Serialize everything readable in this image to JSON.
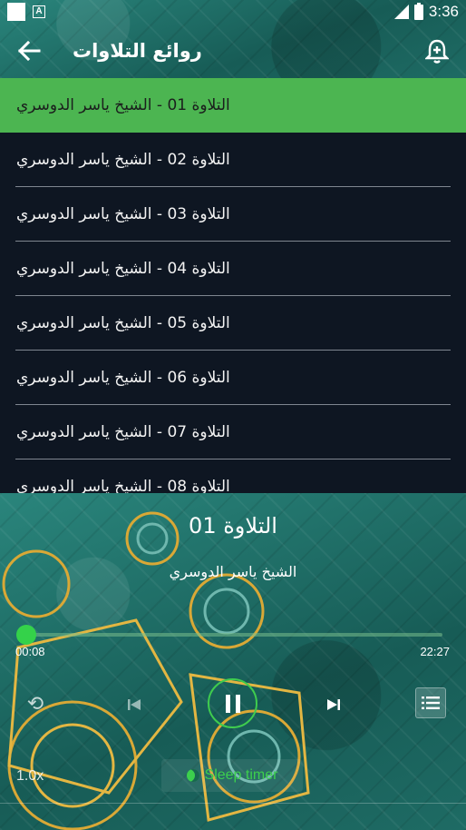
{
  "status_bar": {
    "time": "3:36",
    "icons": [
      "square-notification-icon",
      "a-notification-icon",
      "signal-icon",
      "battery-charging-icon"
    ]
  },
  "toolbar": {
    "title": "روائع التلاوات",
    "back_icon": "arrow-back-icon",
    "alarm_icon": "alarm-add-icon"
  },
  "colors": {
    "active_item": "#4cb551",
    "list_bg": "#0e1622",
    "accent_green": "#3fcc4e",
    "teal": "#1f6f68"
  },
  "tracks": [
    {
      "label": "التلاوة 01 - الشيخ ياسر الدوسري",
      "active": true
    },
    {
      "label": "التلاوة 02 - الشيخ ياسر الدوسري",
      "active": false
    },
    {
      "label": "التلاوة 03 - الشيخ ياسر الدوسري",
      "active": false
    },
    {
      "label": "التلاوة 04 - الشيخ ياسر الدوسري",
      "active": false
    },
    {
      "label": "التلاوة 05 - الشيخ ياسر الدوسري",
      "active": false
    },
    {
      "label": "التلاوة 06 - الشيخ ياسر الدوسري",
      "active": false
    },
    {
      "label": "التلاوة 07 - الشيخ ياسر الدوسري",
      "active": false
    },
    {
      "label": "التلاوة 08 - الشيخ ياسر الدوسري",
      "active": false
    }
  ],
  "player": {
    "title": "التلاوة 01",
    "subtitle": "الشيخ ياسر الدوسري",
    "current_time": "00:08",
    "total_time": "22:27",
    "progress": 0.006,
    "speed_label": "1.0x",
    "sleep_label": "Sleep timer",
    "state": "playing"
  }
}
